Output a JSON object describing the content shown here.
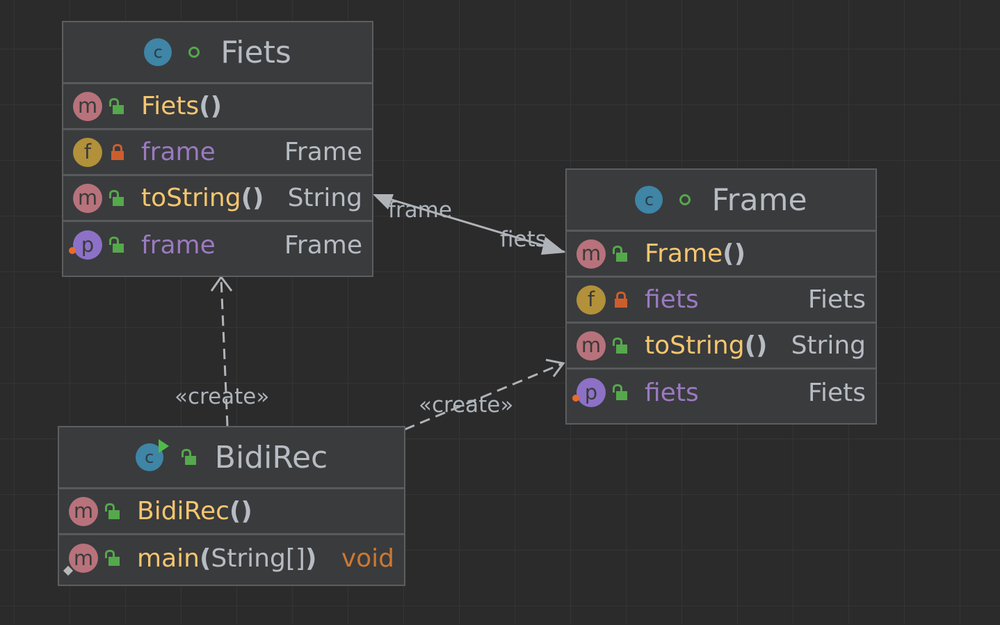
{
  "classes": {
    "fiets": {
      "name": "Fiets",
      "members": [
        {
          "kind": "m",
          "visibility": "public",
          "name": "Fiets",
          "parens": "()",
          "type": ""
        },
        {
          "kind": "f",
          "visibility": "private",
          "name": "frame",
          "type": "Frame"
        },
        {
          "kind": "m",
          "visibility": "public",
          "name": "toString",
          "parens": "()",
          "type": "String"
        },
        {
          "kind": "p",
          "visibility": "public",
          "name": "frame",
          "type": "Frame"
        }
      ]
    },
    "frame": {
      "name": "Frame",
      "members": [
        {
          "kind": "m",
          "visibility": "public",
          "name": "Frame",
          "parens": "()",
          "type": ""
        },
        {
          "kind": "f",
          "visibility": "private",
          "name": "fiets",
          "type": "Fiets"
        },
        {
          "kind": "m",
          "visibility": "public",
          "name": "toString",
          "parens": "()",
          "type": "String"
        },
        {
          "kind": "p",
          "visibility": "public",
          "name": "fiets",
          "type": "Fiets"
        }
      ]
    },
    "bidirec": {
      "name": "BidiRec",
      "members": [
        {
          "kind": "m",
          "visibility": "public",
          "name": "BidiRec",
          "parens": "()",
          "type": ""
        },
        {
          "kind": "m",
          "visibility": "public",
          "static": true,
          "name": "main",
          "paren_open": "(",
          "params": "String[]",
          "paren_close": ")",
          "type": "void"
        }
      ]
    }
  },
  "edges": {
    "association": {
      "source_label": "frame",
      "target_label": "fiets"
    },
    "create_fiets": {
      "label": "«create»"
    },
    "create_frame": {
      "label": "«create»"
    }
  },
  "icon_glyphs": {
    "class": "c",
    "method": "m",
    "field": "f",
    "property": "p"
  },
  "colors": {
    "background": "#2b2b2b",
    "node_fill": "#3a3b3d",
    "method": "#f6c66f",
    "field": "#9b7ac1",
    "type": "#b7bcc3",
    "keyword_void": "#cc7832",
    "public_icon": "#55a84b",
    "private_icon": "#cc5e2d",
    "edge": "#b0b4b8"
  }
}
